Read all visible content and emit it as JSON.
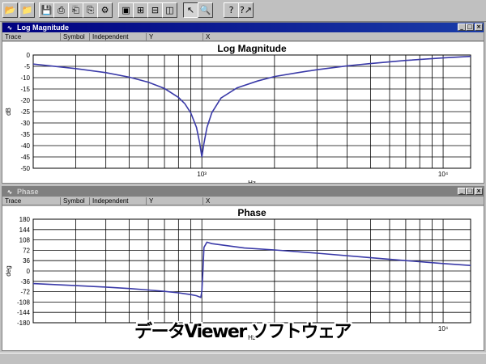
{
  "toolbar": {
    "buttons": [
      {
        "name": "open-folder-icon",
        "glyph": "📂"
      },
      {
        "name": "open-file-icon",
        "glyph": "📁"
      },
      {
        "name": "save-icon",
        "glyph": "💾"
      },
      {
        "name": "print-icon",
        "glyph": "⎙"
      },
      {
        "name": "print-preview-icon",
        "glyph": "⎗"
      },
      {
        "name": "copy-icon",
        "glyph": "⎘"
      },
      {
        "name": "settings-icon",
        "glyph": "⚙"
      },
      {
        "name": "single-plot-icon",
        "glyph": "▣"
      },
      {
        "name": "tile-grid-icon",
        "glyph": "⊞"
      },
      {
        "name": "tile-horizontal-icon",
        "glyph": "⊟"
      },
      {
        "name": "tile-vertical-icon",
        "glyph": "◫"
      },
      {
        "name": "pointer-icon",
        "glyph": "↖"
      },
      {
        "name": "zoom-icon",
        "glyph": "🔍"
      },
      {
        "name": "help-icon",
        "glyph": "?"
      },
      {
        "name": "context-help-icon",
        "glyph": "?↗"
      }
    ]
  },
  "columns": [
    "Trace",
    "Symbol",
    "Independent",
    "Y",
    "X"
  ],
  "window_controls": {
    "minimize": "_",
    "restore": "□",
    "close": "×"
  },
  "windows": {
    "magnitude": {
      "title": "Log Magnitude"
    },
    "phase": {
      "title": "Phase"
    }
  },
  "overlay_text": "データViewer ソフトウェア",
  "colors": {
    "trace": "#3a3aa8",
    "title_active": "#000080",
    "title_inactive": "#808080"
  },
  "chart_data": [
    {
      "type": "line",
      "title": "Log Magnitude",
      "xlabel": "Hz",
      "ylabel": "dB",
      "xscale": "log",
      "xlim": [
        200,
        13000
      ],
      "ylim": [
        -50,
        0
      ],
      "yticks": [
        0,
        -5,
        -10,
        -15,
        -20,
        -25,
        -30,
        -35,
        -40,
        -45,
        -50
      ],
      "xtick_labels": [
        "10³",
        "10⁴"
      ],
      "grid": true,
      "series": [
        {
          "x": [
            200,
            300,
            400,
            500,
            600,
            700,
            800,
            850,
            900,
            950,
            980,
            1000,
            1020,
            1050,
            1100,
            1200,
            1400,
            1700,
            2000,
            2500,
            3000,
            4000,
            5000,
            7000,
            10000,
            13000
          ],
          "y": [
            -4,
            -6,
            -7.8,
            -9.8,
            -12,
            -14.8,
            -18.7,
            -21.5,
            -25.6,
            -32,
            -39,
            -45,
            -39,
            -32,
            -25.5,
            -19,
            -14.5,
            -11.5,
            -9.5,
            -7.8,
            -6.5,
            -4.8,
            -3.8,
            -2.4,
            -1.3,
            -0.6
          ]
        }
      ]
    },
    {
      "type": "line",
      "title": "Phase",
      "xlabel": "Hz",
      "ylabel": "deg",
      "xscale": "log",
      "xlim": [
        200,
        13000
      ],
      "ylim": [
        -180,
        180
      ],
      "yticks": [
        180,
        144,
        108,
        72,
        36,
        0,
        -36,
        -72,
        -108,
        -144,
        -180
      ],
      "xtick_labels": [
        "10³",
        "10⁴"
      ],
      "grid": true,
      "series": [
        {
          "x": [
            200,
            300,
            400,
            500,
            600,
            700,
            800,
            900,
            950,
            990,
            1000,
            1010,
            1020,
            1050,
            1100,
            1500,
            2000,
            3000,
            5000,
            7000,
            10000,
            13000
          ],
          "y": [
            -44,
            -51,
            -56,
            -61,
            -66,
            -71,
            -76,
            -82,
            -86,
            -92,
            -70,
            0,
            82,
            100,
            95,
            80,
            73,
            62,
            46,
            36,
            26,
            19
          ]
        }
      ]
    }
  ]
}
